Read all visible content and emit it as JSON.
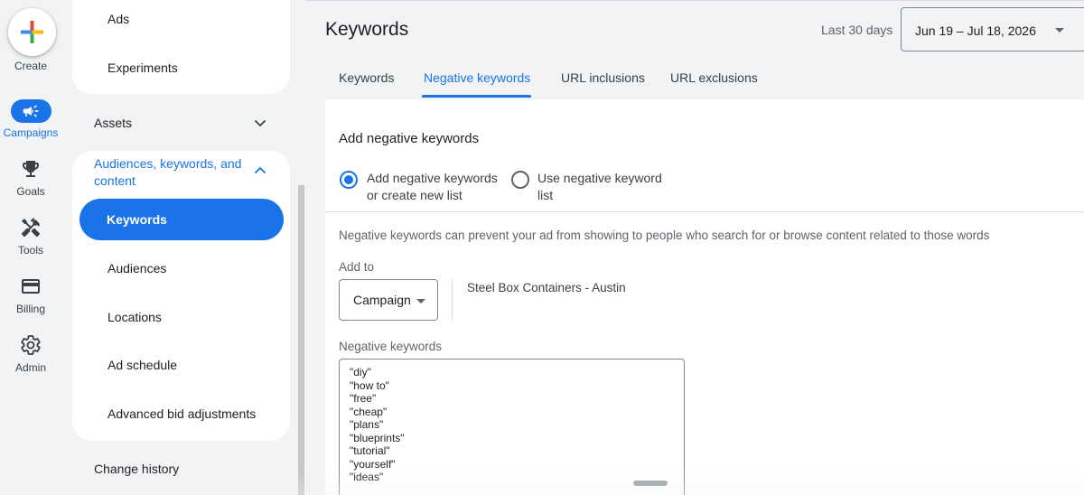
{
  "rail": {
    "create_label": "Create",
    "items": [
      {
        "label": "Campaigns",
        "icon": "megaphone-icon"
      },
      {
        "label": "Goals",
        "icon": "trophy-icon"
      },
      {
        "label": "Tools",
        "icon": "tools-icon"
      },
      {
        "label": "Billing",
        "icon": "credit-card-icon"
      },
      {
        "label": "Admin",
        "icon": "gear-icon"
      }
    ]
  },
  "subnav": {
    "ads": "Ads",
    "experiments": "Experiments",
    "assets": "Assets",
    "audiences_section": "Audiences, keywords, and content",
    "keywords": "Keywords",
    "audiences": "Audiences",
    "locations": "Locations",
    "ad_schedule": "Ad schedule",
    "advanced_bid": "Advanced bid adjustments",
    "change_history": "Change history"
  },
  "header": {
    "title": "Keywords",
    "range_label": "Last 30 days",
    "date_range": "Jun 19 – Jul 18, 2026"
  },
  "tabs": [
    {
      "label": "Keywords",
      "active": false
    },
    {
      "label": "Negative keywords",
      "active": true
    },
    {
      "label": "URL inclusions",
      "active": false
    },
    {
      "label": "URL exclusions",
      "active": false
    }
  ],
  "form": {
    "title": "Add negative keywords",
    "option1_line1": "Add negative keywords",
    "option1_line2": "or create new list",
    "option2_line1": "Use negative keyword",
    "option2_line2": "list",
    "help_text": "Negative keywords can prevent your ad from showing to people who search for or browse content related to those words",
    "add_to_label": "Add to",
    "add_to_value": "Campaign",
    "campaign_name": "Steel Box Containers - Austin",
    "negative_keywords_label": "Negative keywords",
    "negative_keywords": [
      "\"diy\"",
      "\"how to\"",
      "\"free\"",
      "\"cheap\"",
      "\"plans\"",
      "\"blueprints\"",
      "\"tutorial\"",
      "\"yourself\"",
      "\"ideas\""
    ]
  },
  "colors": {
    "accent": "#1a73e8",
    "background": "#f1f3f4"
  }
}
